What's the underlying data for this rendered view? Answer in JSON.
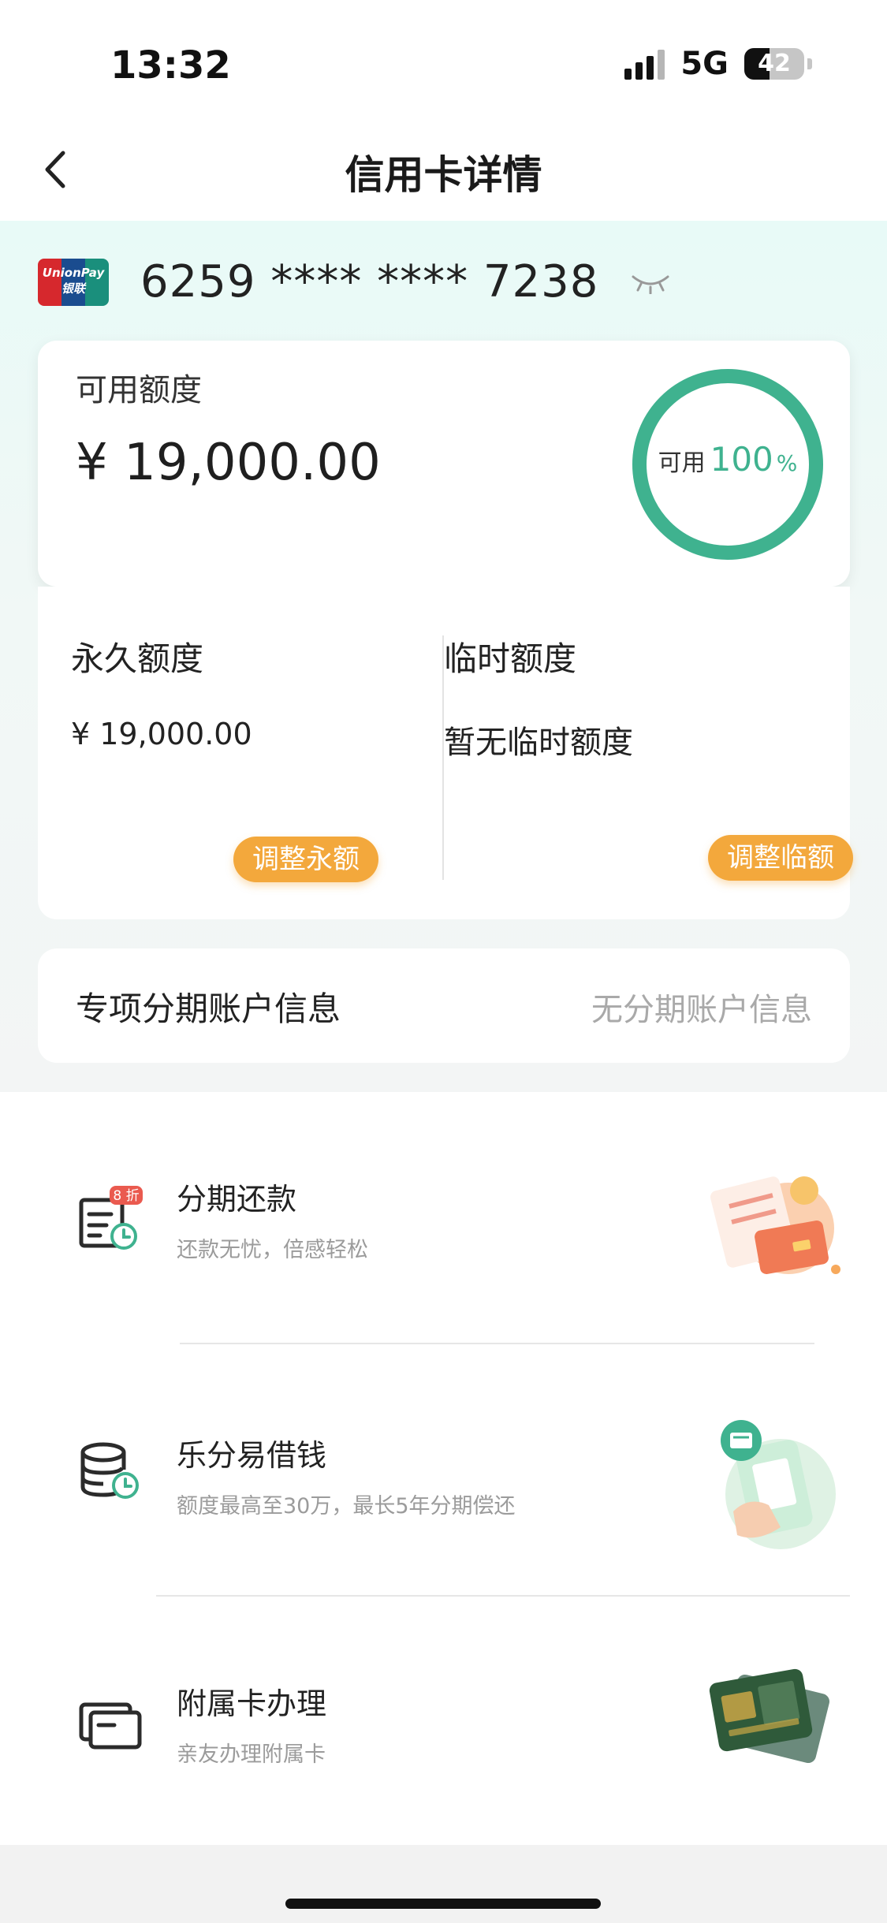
{
  "status_bar": {
    "time": "13:32",
    "network": "5G",
    "battery": "42"
  },
  "nav": {
    "title": "信用卡详情"
  },
  "card": {
    "brand_text": "UnionPay\n银联",
    "number": "6259 **** **** 7238"
  },
  "available": {
    "label": "可用额度",
    "value": "¥ 19,000.00",
    "ring_prefix": "可用",
    "ring_percent": "100",
    "ring_unit": "%",
    "ring_color": "#3fb28f"
  },
  "limits": {
    "permanent": {
      "title": "永久额度",
      "value": "¥ 19,000.00",
      "button": "调整永额"
    },
    "temporary": {
      "title": "临时额度",
      "value": "暂无临时额度",
      "button": "调整临额"
    }
  },
  "installment_account": {
    "label": "专项分期账户信息",
    "value": "无分期账户信息"
  },
  "services": [
    {
      "title": "分期还款",
      "subtitle": "还款无忧，倍感轻松",
      "badge": "8 折"
    },
    {
      "title": "乐分易借钱",
      "subtitle": "额度最高至30万，最长5年分期偿还"
    },
    {
      "title": "附属卡办理",
      "subtitle": "亲友办理附属卡"
    }
  ],
  "colors": {
    "accent": "#3fb28f",
    "button": "#f3a83c"
  }
}
